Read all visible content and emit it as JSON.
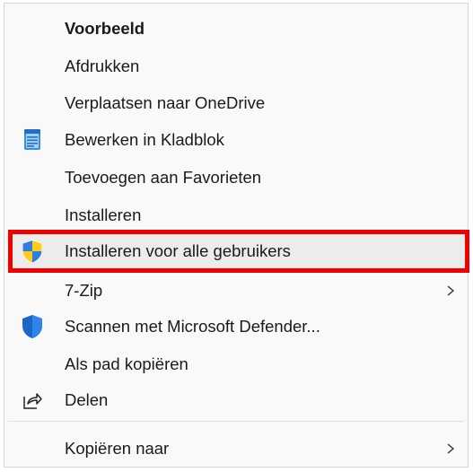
{
  "menu": {
    "items": [
      {
        "label": "Voorbeeld"
      },
      {
        "label": "Afdrukken"
      },
      {
        "label": "Verplaatsen naar OneDrive"
      },
      {
        "label": "Bewerken in Kladblok",
        "icon": "notepad-icon"
      },
      {
        "label": "Toevoegen aan Favorieten"
      },
      {
        "label": "Installeren"
      },
      {
        "label": "Installeren voor alle gebruikers",
        "icon": "uac-shield-icon",
        "highlighted": true
      },
      {
        "label": "7-Zip",
        "submenu": true
      },
      {
        "label": "Scannen met Microsoft Defender...",
        "icon": "defender-shield-icon"
      },
      {
        "label": "Als pad kopiëren"
      },
      {
        "label": "Delen",
        "icon": "share-icon"
      },
      {
        "label": "Kopiëren naar",
        "submenu": true
      }
    ]
  },
  "colors": {
    "highlight_border": "#f20000",
    "hover_background": "#ececec",
    "menu_background": "#f9f9f9"
  }
}
